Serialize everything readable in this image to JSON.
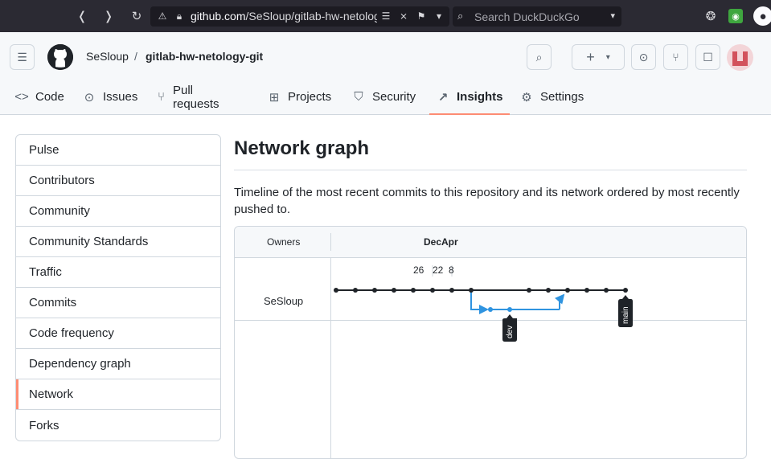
{
  "browser": {
    "url_main": "github.com",
    "url_path": "/SeSloup/gitlab-hw-netology",
    "search_placeholder": "Search DuckDuckGo"
  },
  "header": {
    "owner": "SeSloup",
    "separator": "/",
    "repo": "gitlab-hw-netology-git"
  },
  "tabs": [
    {
      "label": "Code",
      "icon": "code-icon"
    },
    {
      "label": "Issues",
      "icon": "issue-icon"
    },
    {
      "label": "Pull requests",
      "icon": "pull-request-icon"
    },
    {
      "label": "Projects",
      "icon": "table-icon"
    },
    {
      "label": "Security",
      "icon": "shield-icon"
    },
    {
      "label": "Insights",
      "icon": "graph-icon",
      "active": true
    },
    {
      "label": "Settings",
      "icon": "gear-icon"
    }
  ],
  "sidebar": {
    "items": [
      {
        "label": "Pulse"
      },
      {
        "label": "Contributors"
      },
      {
        "label": "Community"
      },
      {
        "label": "Community Standards"
      },
      {
        "label": "Traffic"
      },
      {
        "label": "Commits"
      },
      {
        "label": "Code frequency"
      },
      {
        "label": "Dependency graph"
      },
      {
        "label": "Network",
        "selected": true
      },
      {
        "label": "Forks"
      }
    ]
  },
  "main": {
    "title": "Network graph",
    "description": "Timeline of the most recent commits to this repository and its network ordered by most recently pushed to."
  },
  "network": {
    "owners_label": "Owners",
    "months": [
      "Dec",
      "Apr"
    ],
    "days": [
      "26",
      "22",
      "8"
    ],
    "owner": "SeSloup",
    "branches": [
      "dev",
      "main"
    ],
    "colors": {
      "main": "#1f2328",
      "dev": "#2f94e0",
      "accent": "#fd8c73"
    }
  }
}
